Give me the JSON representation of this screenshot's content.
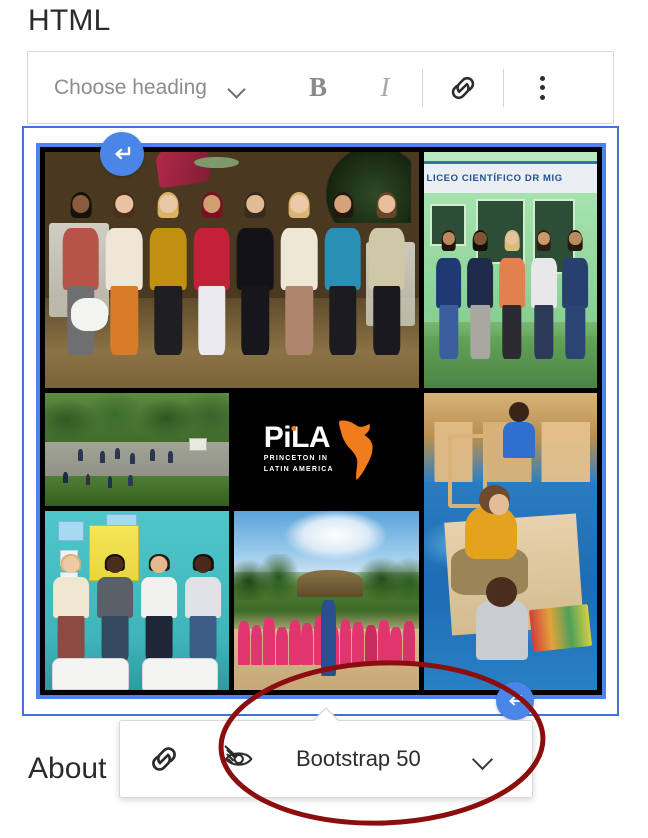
{
  "page_title": "HTML",
  "bottom_heading": "About",
  "toolbar": {
    "heading_select_label": "Choose heading",
    "heading_select_chevron_icon": "chevron-down-icon",
    "bold_label": "B",
    "italic_label": "I",
    "link_icon": "link-icon",
    "more_options_icon": "kebab-menu-icon"
  },
  "block": {
    "type": "image-block",
    "selected": true,
    "selection_border_color": "#3f76d6",
    "image_border_color": "#4a86e8",
    "insert_before_button_icon": "return-arrow-icon",
    "insert_after_button_icon": "return-arrow-icon",
    "collage": {
      "background_color": "#000000",
      "tiles": [
        {
          "name": "group-photo-night",
          "description": "Group of eight students posing at night on sand near white benches"
        },
        {
          "name": "liceo-cientifico-photo",
          "sign_text": "LICEO CIENTÍFICO DR MIG",
          "description": "Five people in front of a light green school building"
        },
        {
          "name": "schoolyard-photo",
          "description": "Students on an outdoor basketball court surrounded by trees"
        },
        {
          "name": "pila-logo",
          "logo_word": "PiLA",
          "logo_subtitle_line1": "PRINCETON IN",
          "logo_subtitle_line2": "LATIN AMERICA",
          "logo_accent_color": "#f07c1e",
          "logo_background_color": "#000000"
        },
        {
          "name": "classroom-reading-photo",
          "description": "Woman in yellow top sitting on a blue floor reading a picture book with a child"
        },
        {
          "name": "teal-classroom-photo",
          "description": "Four people smiling in front of a teal classroom wall with posters"
        },
        {
          "name": "pink-shirts-crowd-photo",
          "description": "Large crowd of children in pink shirts outdoors with palm trees and a thatched hut"
        }
      ]
    }
  },
  "popup_toolbar": {
    "link_icon": "link-icon",
    "hide_icon": "eye-slash-icon",
    "style_name": "Bootstrap 50",
    "style_chevron_icon": "chevron-down-icon"
  },
  "annotation": {
    "shape": "ellipse",
    "color": "#8c0d0d",
    "target": "Bootstrap 50"
  }
}
